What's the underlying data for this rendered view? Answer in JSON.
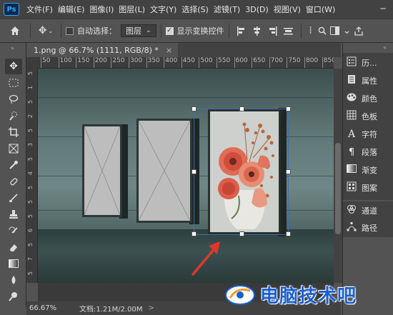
{
  "app": {
    "logo": "Ps"
  },
  "menu": [
    "文件(F)",
    "编辑(E)",
    "图像(I)",
    "图层(L)",
    "文字(Y)",
    "选择(S)",
    "滤镜(T)",
    "3D(D)",
    "视图(V)",
    "窗口(W)"
  ],
  "window_controls": [
    "minimize-icon",
    "restore-icon",
    "close-icon"
  ],
  "options": {
    "auto_select_label": "自动选择：",
    "auto_select_checked": false,
    "layer_select_value": "图层",
    "show_transform_label": "显示变换控件",
    "show_transform_checked": true
  },
  "document_tab": {
    "title": "1.png @ 66.7% (1111, RGB/8) *",
    "close": "×"
  },
  "ruler": {
    "h_ticks": [
      "50",
      "100",
      "150",
      "200",
      "250",
      "300",
      "350",
      "400",
      "450",
      "500",
      "550",
      "600",
      "650",
      "700",
      "750",
      "800",
      "850"
    ],
    "v_ticks": [
      "5",
      "1",
      "5",
      "2",
      "5",
      "3",
      "5",
      "4",
      "5",
      "5",
      "5",
      "6",
      "5",
      "7",
      "5"
    ]
  },
  "status": {
    "zoom": "66.67%",
    "doc_info": "文档:1.21M/2.00M",
    "arrow": ">"
  },
  "right_panels": {
    "group1": [
      "历...",
      "属性",
      "颜色",
      "色板",
      "字符",
      "段落",
      "渐变",
      "图案"
    ],
    "group2": [
      "通道",
      "路径"
    ]
  },
  "watermark": {
    "text": "电脑技术吧"
  },
  "colors": {
    "menubar": "#424242",
    "workspace": "#535353",
    "accent": "#31a8ff",
    "watermark": "#1a5fd0",
    "annotation_arrow": "#e0362a"
  }
}
